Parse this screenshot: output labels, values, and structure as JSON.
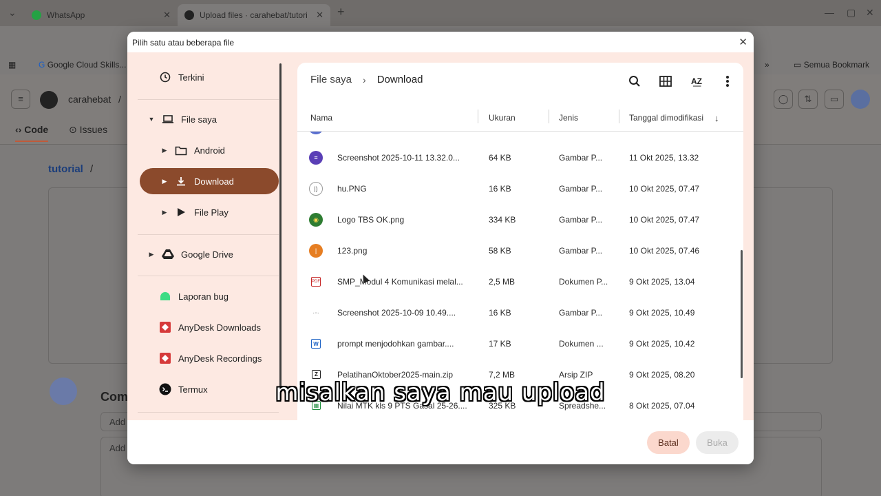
{
  "browser": {
    "tabs": [
      {
        "title": "WhatsApp",
        "favicon_color": "#25a244"
      },
      {
        "title": "Upload files · carahebat/tutori",
        "favicon_color": "#222222"
      }
    ],
    "new_tab_icon": "plus-icon",
    "address": "github",
    "bookmarks": [
      "Google Cloud Skills...",
      "Semua Bookmark"
    ]
  },
  "github": {
    "owner": "carahebat",
    "path_sep": "/",
    "tabs": [
      "Code",
      "Issues"
    ],
    "repo_crumb": "tutorial",
    "crumb_sep": "/",
    "comment_heading": "Com",
    "comment_placeholder": "Add",
    "desc_placeholder": "Add"
  },
  "dialog": {
    "title": "Pilih satu atau beberapa file",
    "sidebar": {
      "items": [
        {
          "label": "Terkini",
          "icon": "clock-icon"
        },
        {
          "label": "File saya",
          "icon": "laptop-icon",
          "expanded": true
        },
        {
          "label": "Android",
          "icon": "folder-icon"
        },
        {
          "label": "Download",
          "icon": "download-icon",
          "active": true
        },
        {
          "label": "File Play",
          "icon": "play-files-icon"
        },
        {
          "label": "Google Drive",
          "icon": "google-drive-icon"
        },
        {
          "label": "Laporan bug",
          "icon": "android-icon"
        },
        {
          "label": "AnyDesk Downloads",
          "icon": "anydesk-icon"
        },
        {
          "label": "AnyDesk Recordings",
          "icon": "anydesk-icon"
        },
        {
          "label": "Termux",
          "icon": "termux-icon"
        }
      ]
    },
    "breadcrumb": {
      "root": "File saya",
      "current": "Download"
    },
    "toolbar": [
      "search-icon",
      "grid-view-icon",
      "sort-az-icon",
      "more-vert-icon"
    ],
    "columns": {
      "name": "Nama",
      "size": "Ukuran",
      "type": "Jenis",
      "date": "Tanggal dimodifikasi"
    },
    "files": [
      {
        "name": "Screenshot 2025-10-11 13.32.0...",
        "size": "64 KB",
        "type": "Gambar P...",
        "date": "11 Okt 2025, 13.32",
        "icon_color": "#5a3fb6"
      },
      {
        "name": "hu.PNG",
        "size": "16 KB",
        "type": "Gambar P...",
        "date": "10 Okt 2025, 07.47",
        "icon_color": "#9a9a9a"
      },
      {
        "name": "Logo TBS OK.png",
        "size": "334 KB",
        "type": "Gambar P...",
        "date": "10 Okt 2025, 07.47",
        "icon_color": "#2e7d32"
      },
      {
        "name": "123.png",
        "size": "58 KB",
        "type": "Gambar P...",
        "date": "10 Okt 2025, 07.46",
        "icon_color": "#e67e22"
      },
      {
        "name": "SMP_Modul 4 Komunikasi melal...",
        "size": "2,5 MB",
        "type": "Dokumen P...",
        "date": "9 Okt 2025, 13.04",
        "icon_color": "#c62828"
      },
      {
        "name": "Screenshot 2025-10-09 10.49....",
        "size": "16 KB",
        "type": "Gambar P...",
        "date": "9 Okt 2025, 10.49",
        "icon_color": "#bdbdbd"
      },
      {
        "name": "prompt menjodohkan gambar....",
        "size": "17 KB",
        "type": "Dokumen ...",
        "date": "9 Okt 2025, 10.42",
        "icon_color": "#1e63c5"
      },
      {
        "name": "PelatihanOktober2025-main.zip",
        "size": "7,2 MB",
        "type": "Arsip ZIP",
        "date": "9 Okt 2025, 08.20",
        "icon_color": "#222222"
      },
      {
        "name": "Nilai MTK kls 9 PTS Gasal 25-26....",
        "size": "325 KB",
        "type": "Spreadshe...",
        "date": "8 Okt 2025, 07.04",
        "icon_color": "#1e8e3e"
      }
    ],
    "buttons": {
      "cancel": "Batal",
      "open": "Buka"
    }
  },
  "caption": "misalkan saya mau upload",
  "colors": {
    "accent": "#8b4a2c",
    "panel_bg": "#fde9e2",
    "cancel_bg": "#fbd8cd"
  }
}
